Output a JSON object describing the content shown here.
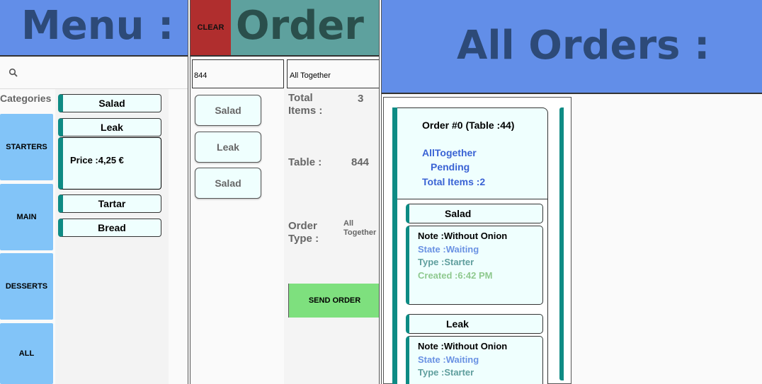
{
  "menu": {
    "title": "Menu :",
    "search_placeholder": "",
    "categories_label": "Categories",
    "categories": [
      "STARTERS",
      "MAIN",
      "DESSERTS",
      "ALL"
    ],
    "items": [
      "Salad",
      "Leak",
      "Tartar",
      "Bread"
    ],
    "price_text": "Price :4,25 €"
  },
  "order": {
    "clear_label": "CLEAR",
    "title": "Order :",
    "table_field_value": "844",
    "type_field_value": "All Together",
    "items": [
      "Salad",
      "Leak",
      "Salad"
    ],
    "total_items_label": "Total\nItems :",
    "total_items_value": "3",
    "table_label": "Table :",
    "table_value": "844",
    "order_type_label": "Order\nType :",
    "order_type_value": "All\nTogether",
    "send_label": "SEND ORDER"
  },
  "all_orders": {
    "title": "All Orders :",
    "order": {
      "title": "Order #0   (Table :44)",
      "mode": "AllTogether",
      "status": "Pending",
      "total": "Total Items :2",
      "lines": [
        {
          "name": "Salad",
          "note": "Note :Without Onion",
          "state": "State :Waiting",
          "type": "Type :Starter",
          "created": "Created :6:42 PM"
        },
        {
          "name": "Leak",
          "note": "Note :Without Onion",
          "state": "State :Waiting",
          "type": "Type :Starter"
        }
      ]
    }
  },
  "colors": {
    "header_blue": "#628ee8",
    "header_teal": "#5ea19e",
    "clear_red": "#b02e2e",
    "category_blue": "#82c4f8",
    "accent_teal": "#0e8b84",
    "send_green": "#7ee07e"
  },
  "icons": {
    "search": "search-icon"
  }
}
